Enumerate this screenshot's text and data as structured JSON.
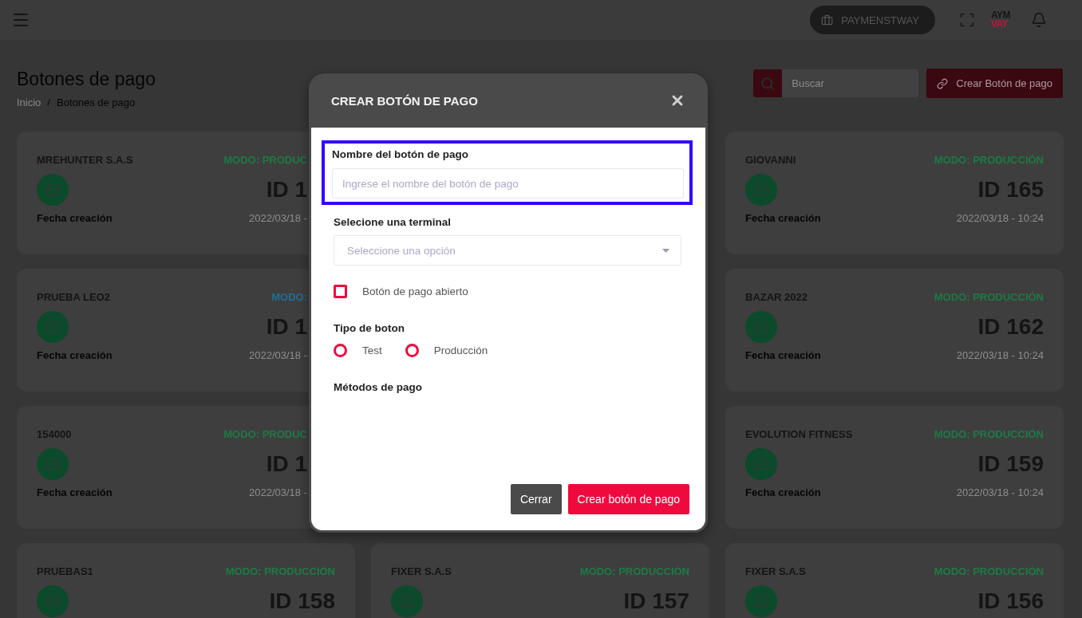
{
  "top_bar": {
    "company": "PAYMENSTWAY",
    "logo": {
      "line1": "AYM",
      "line2": "VAY"
    }
  },
  "header": {
    "title": "Botones de pago",
    "breadcrumb": [
      "Inicio",
      "Botones de pago"
    ],
    "separator": "/",
    "search_placeholder": "Buscar",
    "create_button": "Crear Botón de pago"
  },
  "card_rows": [
    [
      {
        "name": "MREHUNTER S.A.S",
        "mode": "MODO: PRODUC",
        "color": "#1d7a45",
        "id": "ID 1",
        "date_label": "Fecha creación",
        "date": "2022/03/18 -"
      },
      {
        "name": "GIOVANNI",
        "mode": "MODO: PRODUCCIÓN",
        "color": "#1d7a45",
        "id": "ID 165",
        "date_label": "Fecha creación",
        "date": "2022/03/18 - 10:24"
      }
    ],
    [
      {
        "name": "PRUEBA LEO2",
        "mode": "MODO:",
        "color": "#1f6e9a",
        "id": "ID 1",
        "date_label": "Fecha creación",
        "date": "2022/03/18 -"
      },
      {
        "name": "BAZAR 2022",
        "mode": "MODO: PRODUCCIÓN",
        "color": "#1d7a45",
        "id": "ID 162",
        "date_label": "Fecha creación",
        "date": "2022/03/18 - 10:24"
      }
    ],
    [
      {
        "name": "154000",
        "mode": "MODO: PRODUC",
        "color": "#1d7a45",
        "id": "ID 1",
        "date_label": "Fecha creación",
        "date": "2022/03/18 -"
      },
      {
        "name": "EVOLUTION FITNESS",
        "mode": "MODO: PRODUCCIÓN",
        "color": "#1d7a45",
        "id": "ID 159",
        "date_label": "Fecha creación",
        "date": "2022/03/18 - 10:24"
      }
    ],
    [
      {
        "name": "PRUEBAS1",
        "mode": "MODO: PRODUCCIÓN",
        "color": "#1d7a45",
        "id": "ID 158"
      },
      {
        "name": "FIXER S.A.S",
        "mode": "MODO: PRODUCCIÓN",
        "color": "#1d7a45",
        "id": "ID 157"
      },
      {
        "name": "FIXER S.A.S",
        "mode": "MODO: PRODUCCIÓN",
        "color": "#1d7a45",
        "id": "ID 156"
      }
    ]
  ],
  "modal": {
    "title": "CREAR BOTÓN DE PAGO",
    "name_field": {
      "label": "Nombre del botón de pago",
      "placeholder": "Ingrese el nombre del botón de pago",
      "focused": true
    },
    "terminal_select": {
      "label": "Selecione una terminal",
      "placeholder": "Seleccione una opción"
    },
    "open_checkbox": {
      "label": "Botón de pago abierto",
      "checked": false
    },
    "button_type": {
      "label": "Tipo de boton",
      "options": [
        {
          "label": "Test",
          "selected": false
        },
        {
          "label": "Producción",
          "selected": false
        }
      ]
    },
    "payment_methods": {
      "label": "Métodos de pago"
    },
    "buttons": [
      {
        "label": "Cerrar",
        "kind": "secondary"
      },
      {
        "label": "Crear botón de pago",
        "kind": "primary"
      }
    ]
  }
}
